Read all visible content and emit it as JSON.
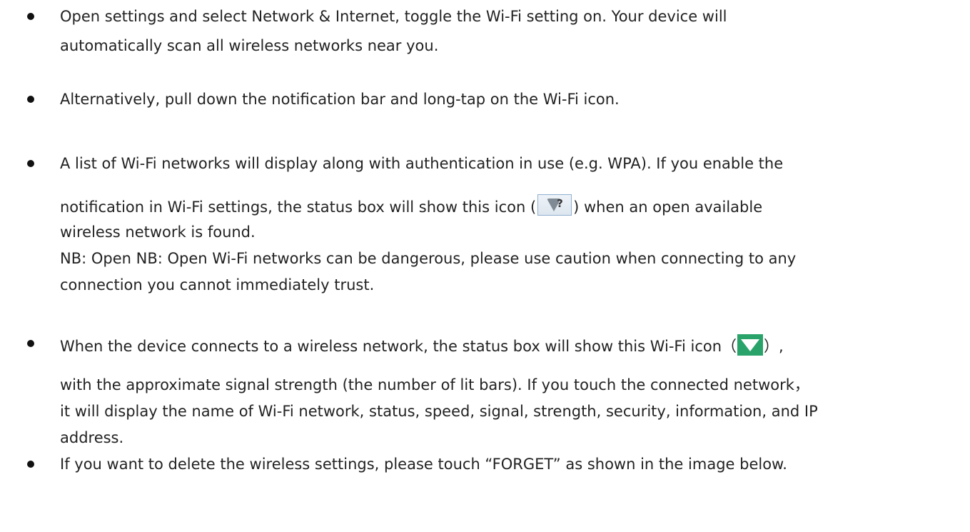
{
  "bullets": [
    {
      "lines": [
        "Open settings and select Network & Internet, toggle the Wi-Fi setting on. Your device will",
        "automatically scan all wireless networks near you."
      ]
    },
    {
      "lines": [
        "Alternatively, pull down the notification bar and long-tap on the Wi-Fi icon."
      ]
    },
    {
      "line1": "A list of Wi-Fi networks will display along with authentication in use (e.g. WPA). If you enable the",
      "line2_before": "notification in Wi-Fi settings, the status box will show this icon (",
      "line2_after": ") when an open available",
      "line3": "wireless network is found.",
      "note_line1": "NB: Open NB: Open Wi-Fi networks can be dangerous, please use caution when connecting to any",
      "note_line2": "connection you cannot immediately trust."
    },
    {
      "line1_before": "When the device connects to a wireless network, the status box will show this Wi-Fi icon（",
      "line1_after": "）,",
      "line2": "with the approximate signal strength (the number of lit bars). If you touch the connected network，",
      "line3": "it will display the name of Wi-Fi network, status, speed, signal, strength, security, information, and IP",
      "line4": "address."
    },
    {
      "lines": [
        "If you want to delete the wireless settings, please touch “FORGET” as shown in the image below."
      ]
    }
  ],
  "icons": {
    "open_network_icon": "wifi-question-icon",
    "connected_icon": "wifi-connected-icon",
    "connected_icon_color": "#2aa36b",
    "open_network_border": "#8fb0cf"
  }
}
